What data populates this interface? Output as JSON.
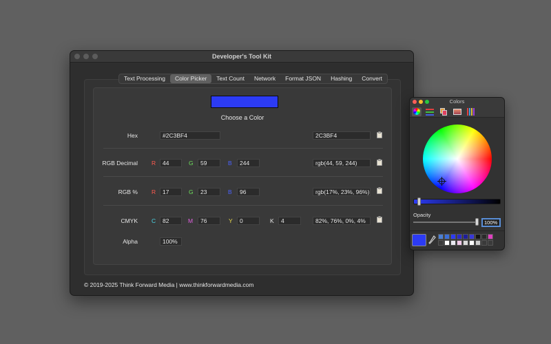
{
  "window": {
    "title": "Developer's Tool Kit",
    "tabs": [
      {
        "label": "Text Processing",
        "active": false
      },
      {
        "label": "Color Picker",
        "active": true
      },
      {
        "label": "Text Count",
        "active": false
      },
      {
        "label": "Network",
        "active": false
      },
      {
        "label": "Format JSON",
        "active": false
      },
      {
        "label": "Hashing",
        "active": false
      },
      {
        "label": "Convert",
        "active": false
      }
    ],
    "footer": "© 2019-2025 Think Forward Media | www.thinkforwardmedia.com"
  },
  "picker": {
    "swatch_color": "#2C3BF4",
    "choose_label": "Choose a Color",
    "hex": {
      "label": "Hex",
      "value": "#2C3BF4",
      "output": "2C3BF4"
    },
    "rgb_decimal": {
      "label": "RGB Decimal",
      "r_label": "R",
      "r": "44",
      "g_label": "G",
      "g": "59",
      "b_label": "B",
      "b": "244",
      "output": "rgb(44, 59, 244)"
    },
    "rgb_percent": {
      "label": "RGB %",
      "r_label": "R",
      "r": "17",
      "g_label": "G",
      "g": "23",
      "b_label": "B",
      "b": "96",
      "output": "rgb(17%, 23%, 96%)"
    },
    "cmyk": {
      "label": "CMYK",
      "c_label": "C",
      "c": "82",
      "m_label": "M",
      "m": "76",
      "y_label": "Y",
      "y": "0",
      "k_label": "K",
      "k": "4",
      "output": "82%, 76%, 0%, 4%"
    },
    "alpha": {
      "label": "Alpha",
      "value": "100%"
    }
  },
  "colors_panel": {
    "title": "Colors",
    "tools": [
      "color-wheel-icon",
      "sliders-icon",
      "palettes-icon",
      "image-palette-icon",
      "pencils-icon"
    ],
    "selected_tool": "color-wheel-icon",
    "brightness_color": "#2C3BF4",
    "brightness_level": 0.05,
    "opacity_label": "Opacity",
    "opacity_value": "100%",
    "opacity_level": 1.0,
    "current_color": "#2C3BF4",
    "favorites": [
      "#4a7fd4",
      "#3a6ed8",
      "#2c3bf4",
      "#2a2ac8",
      "#1e1e9a",
      "#3838d8",
      "#141414",
      "#2a2a2a",
      "#e040c0",
      "#3a3a3a",
      "#ffffff",
      "#e8e8f0",
      "#f0c8e8",
      "#d8d8d8",
      "#ffffff",
      "#cccccc",
      "#3a3a3a",
      "#3a3a3a"
    ]
  }
}
